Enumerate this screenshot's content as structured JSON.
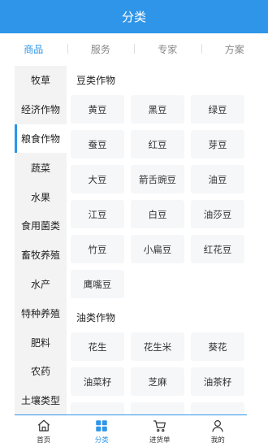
{
  "header": {
    "title": "分类"
  },
  "tabs": [
    {
      "label": "商品",
      "active": true
    },
    {
      "label": "服务",
      "active": false
    },
    {
      "label": "专家",
      "active": false
    },
    {
      "label": "方案",
      "active": false
    }
  ],
  "sidebar": {
    "items": [
      {
        "label": "牧草"
      },
      {
        "label": "经济作物"
      },
      {
        "label": "粮食作物",
        "active": true
      },
      {
        "label": "蔬菜"
      },
      {
        "label": "水果"
      },
      {
        "label": "食用菌类"
      },
      {
        "label": "畜牧养殖"
      },
      {
        "label": "水产"
      },
      {
        "label": "特种养殖"
      },
      {
        "label": "肥料"
      },
      {
        "label": "农药"
      },
      {
        "label": "土壤类型"
      }
    ]
  },
  "sections": [
    {
      "title": "豆类作物",
      "items": [
        "黄豆",
        "黑豆",
        "绿豆",
        "蚕豆",
        "红豆",
        "芽豆",
        "大豆",
        "箭舌豌豆",
        "油豆",
        "江豆",
        "白豆",
        "油莎豆",
        "竹豆",
        "小扁豆",
        "红花豆",
        "鹰嘴豆"
      ]
    },
    {
      "title": "油类作物",
      "items": [
        "花生",
        "花生米",
        "葵花",
        "油菜籽",
        "芝麻",
        "油茶籽",
        "",
        "",
        ""
      ]
    }
  ],
  "bottom_nav": {
    "items": [
      {
        "label": "首页",
        "icon": "home-icon"
      },
      {
        "label": "分类",
        "icon": "grid-icon",
        "active": true
      },
      {
        "label": "进货单",
        "icon": "cart-icon"
      },
      {
        "label": "我的",
        "icon": "user-icon"
      }
    ]
  },
  "colors": {
    "accent": "#2f95e8",
    "sidebar_bg": "#f3f3f3",
    "chip_bg": "#f5f7f9"
  }
}
